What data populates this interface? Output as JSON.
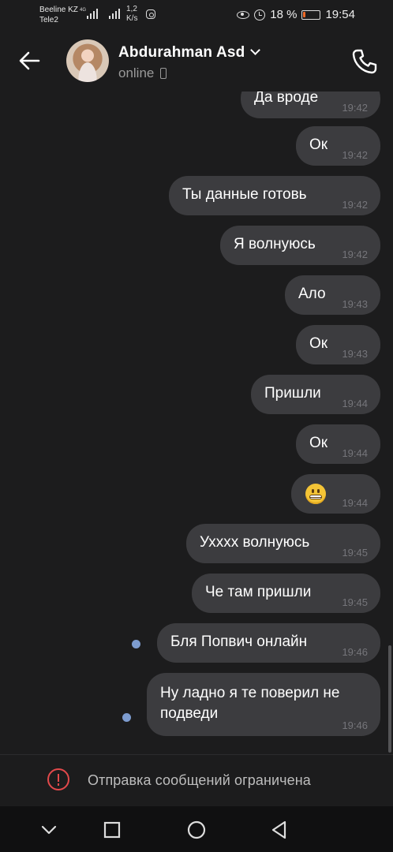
{
  "status_bar": {
    "carrier1": "Beeline KZ",
    "carrier2": "Tele2",
    "network": "4G",
    "speed_value": "1,2",
    "speed_unit": "K/s",
    "battery_percent": "18 %",
    "battery_level": 0.18,
    "time": "19:54",
    "icons": [
      "signal-icon",
      "instagram-icon",
      "eye-icon",
      "alarm-icon",
      "battery-icon"
    ]
  },
  "header": {
    "contact_name": "Abdurahman Asd",
    "status": "online",
    "icons": [
      "back-arrow-icon",
      "chevron-down-icon",
      "mobile-device-icon",
      "phone-call-icon"
    ]
  },
  "messages": [
    {
      "text": "Да вроде",
      "time": "19:42"
    },
    {
      "text": "Ок",
      "time": "19:42"
    },
    {
      "text": "Ты данные готовь",
      "time": "19:42"
    },
    {
      "text": "Я волнуюсь",
      "time": "19:42"
    },
    {
      "text": "Ало",
      "time": "19:43"
    },
    {
      "text": "Ок",
      "time": "19:43"
    },
    {
      "text": "Пришли",
      "time": "19:44"
    },
    {
      "text": "Ок",
      "time": "19:44"
    },
    {
      "text": "",
      "emoji": "grimacing-face-emoji",
      "time": "19:44"
    },
    {
      "text": "Ухххх волнуюсь",
      "time": "19:45"
    },
    {
      "text": "Че там пришли",
      "time": "19:45"
    },
    {
      "text": "Бля Попвич онлайн",
      "time": "19:46",
      "unread": true
    },
    {
      "text": "Ну ладно я те поверил не подведи",
      "time": "19:46",
      "unread": true
    }
  ],
  "footer": {
    "restriction_text": "Отправка сообщений ограничена",
    "alert_color": "#e2494b"
  },
  "nav": {
    "icons": [
      "nav-back-chevron-icon",
      "nav-recents-square-icon",
      "nav-home-circle-icon",
      "nav-back-triangle-icon"
    ]
  },
  "colors": {
    "background": "#1c1c1d",
    "bubble": "#3c3c3f",
    "unread_dot": "#7d9ccf",
    "battery_low": "#f06a27"
  }
}
